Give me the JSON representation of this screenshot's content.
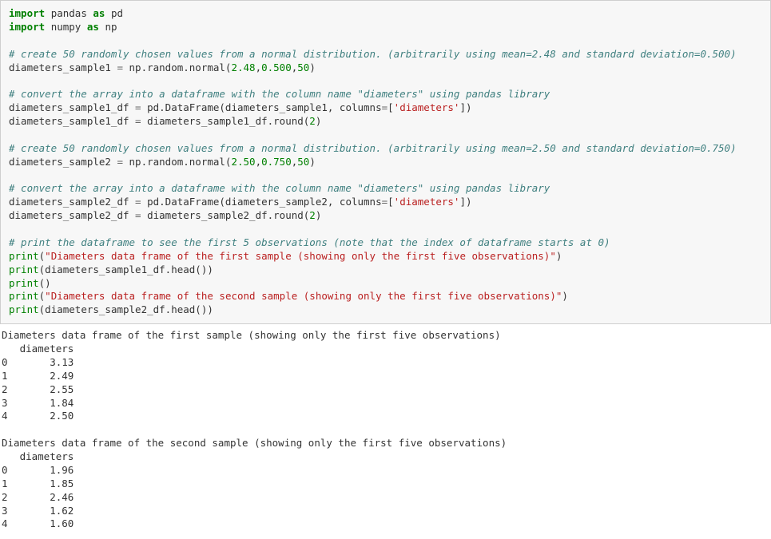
{
  "code": {
    "l1_kw1": "import",
    "l1_mod": "pandas",
    "l1_kw2": "as",
    "l1_alias": "pd",
    "l2_kw1": "import",
    "l2_mod": "numpy",
    "l2_kw2": "as",
    "l2_alias": "np",
    "c1": "# create 50 randomly chosen values from a normal distribution. (arbitrarily using mean=2.48 and standard deviation=0.500)",
    "l3_lhs": "diameters_sample1 ",
    "l3_eq": "=",
    "l3_rhs_pre": " np.random.normal(",
    "l3_arg1": "2.48",
    "l3_comma1": ",",
    "l3_arg2": "0.500",
    "l3_comma2": ",",
    "l3_arg3": "50",
    "l3_rhs_post": ")",
    "c2": "# convert the array into a dataframe with the column name \"diameters\" using pandas library",
    "l4_lhs": "diameters_sample1_df ",
    "l4_eq": "=",
    "l4_rhs_pre": " pd.DataFrame(diameters_sample1, columns",
    "l4_eq2": "=",
    "l4_brkt": "[",
    "l4_str": "'diameters'",
    "l4_rhs_post": "])",
    "l5_lhs": "diameters_sample1_df ",
    "l5_eq": "=",
    "l5_rhs_pre": " diameters_sample1_df.round(",
    "l5_arg": "2",
    "l5_rhs_post": ")",
    "c3": "# create 50 randomly chosen values from a normal distribution. (arbitrarily using mean=2.50 and standard deviation=0.750)",
    "l6_lhs": "diameters_sample2 ",
    "l6_eq": "=",
    "l6_rhs_pre": " np.random.normal(",
    "l6_arg1": "2.50",
    "l6_comma1": ",",
    "l6_arg2": "0.750",
    "l6_comma2": ",",
    "l6_arg3": "50",
    "l6_rhs_post": ")",
    "c4": "# convert the array into a dataframe with the column name \"diameters\" using pandas library",
    "l7_lhs": "diameters_sample2_df ",
    "l7_eq": "=",
    "l7_rhs_pre": " pd.DataFrame(diameters_sample2, columns",
    "l7_eq2": "=",
    "l7_brkt": "[",
    "l7_str": "'diameters'",
    "l7_rhs_post": "])",
    "l8_lhs": "diameters_sample2_df ",
    "l8_eq": "=",
    "l8_rhs_pre": " diameters_sample2_df.round(",
    "l8_arg": "2",
    "l8_rhs_post": ")",
    "c5": "# print the dataframe to see the first 5 observations (note that the index of dataframe starts at 0)",
    "p1_fn": "print",
    "p1_paren": "(",
    "p1_str": "\"Diameters data frame of the first sample (showing only the first five observations)\"",
    "p1_close": ")",
    "p2_fn": "print",
    "p2_pre": "(diameters_sample1_df.head())",
    "p3_fn": "print",
    "p3_post": "()",
    "p4_fn": "print",
    "p4_paren": "(",
    "p4_str": "\"Diameters data frame of the second sample (showing only the first five observations)\"",
    "p4_close": ")",
    "p5_fn": "print",
    "p5_pre": "(diameters_sample2_df.head())"
  },
  "output": {
    "h1": "Diameters data frame of the first sample (showing only the first five observations)",
    "col1": "   diameters",
    "s1r0": "0       3.13",
    "s1r1": "1       2.49",
    "s1r2": "2       2.55",
    "s1r3": "3       1.84",
    "s1r4": "4       2.50",
    "blank": "",
    "h2": "Diameters data frame of the second sample (showing only the first five observations)",
    "col2": "   diameters",
    "s2r0": "0       1.96",
    "s2r1": "1       1.85",
    "s2r2": "2       2.46",
    "s2r3": "3       1.62",
    "s2r4": "4       1.60"
  }
}
